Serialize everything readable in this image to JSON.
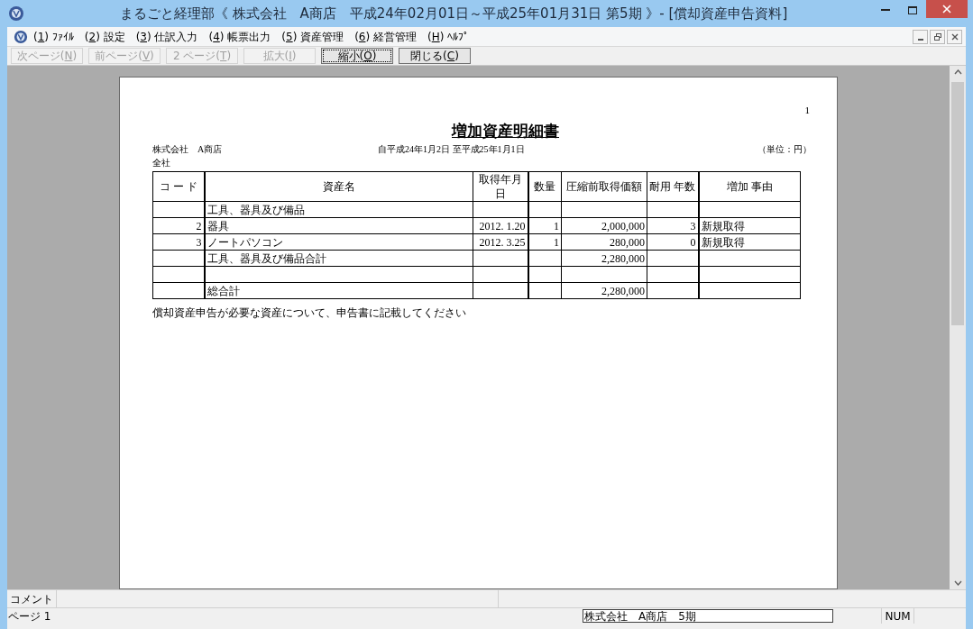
{
  "window": {
    "title": "まるごと経理部《 株式会社　A商店　平成24年02月01日～平成25年01月31日 第5期 》- [償却資産申告資料]"
  },
  "menu": [
    {
      "before": "(",
      "mnemonic": "1",
      "after": ") ﾌｧｲﾙ"
    },
    {
      "before": "(",
      "mnemonic": "2",
      "after": ") 設定"
    },
    {
      "before": "(",
      "mnemonic": "3",
      "after": ") 仕訳入力"
    },
    {
      "before": "(",
      "mnemonic": "4",
      "after": ") 帳票出力"
    },
    {
      "before": "(",
      "mnemonic": "5",
      "after": ") 資産管理"
    },
    {
      "before": "(",
      "mnemonic": "6",
      "after": ") 経営管理"
    },
    {
      "before": "(",
      "mnemonic": "H",
      "after": ") ﾍﾙﾌﾟ"
    }
  ],
  "toolbar": [
    {
      "before": "次ページ(",
      "mnemonic": "N",
      "after": ")",
      "disabled": true,
      "focused": false
    },
    {
      "before": "前ページ(",
      "mnemonic": "V",
      "after": ")",
      "disabled": true,
      "focused": false
    },
    {
      "before": "2 ページ(",
      "mnemonic": "T",
      "after": ")",
      "disabled": true,
      "focused": false
    },
    {
      "before": "拡大(",
      "mnemonic": "I",
      "after": ")",
      "disabled": true,
      "focused": false
    },
    {
      "before": "縮小(",
      "mnemonic": "O",
      "after": ")",
      "disabled": false,
      "focused": true
    },
    {
      "before": "閉じる(",
      "mnemonic": "C",
      "after": ")",
      "disabled": false,
      "focused": false
    }
  ],
  "report": {
    "page_number": "1",
    "title": "増加資産明細書",
    "company": "株式会社　A商店",
    "period": "自平成24年1月2日 至平成25年1月1日",
    "unit": "（単位：円）",
    "division": "全社",
    "table": {
      "columns": [
        "コ ー ド",
        "資産名",
        "取得年月日",
        "数量",
        "圧縮前取得価額",
        "耐用 年数",
        "増加 事由"
      ],
      "rows": [
        [
          "",
          "工具、器具及び備品",
          "",
          "",
          "",
          "",
          ""
        ],
        [
          "2",
          "器具",
          "2012. 1.20",
          "1",
          "2,000,000",
          "3",
          "新規取得"
        ],
        [
          "3",
          "ノートパソコン",
          "2012. 3.25",
          "1",
          "280,000",
          "0",
          "新規取得"
        ],
        [
          "",
          "工具、器具及び備品合計",
          "",
          "",
          "2,280,000",
          "",
          ""
        ],
        [
          "",
          "",
          "",
          "",
          "",
          "",
          ""
        ],
        [
          "",
          "総合計",
          "",
          "",
          "2,280,000",
          "",
          ""
        ]
      ]
    },
    "note": "償却資産申告が必要な資産について、申告書に記載してください"
  },
  "status_bar": {
    "comment_label": "コメント",
    "page": "ページ 1",
    "company_field": "株式会社　A商店　5期",
    "num": "NUM"
  }
}
